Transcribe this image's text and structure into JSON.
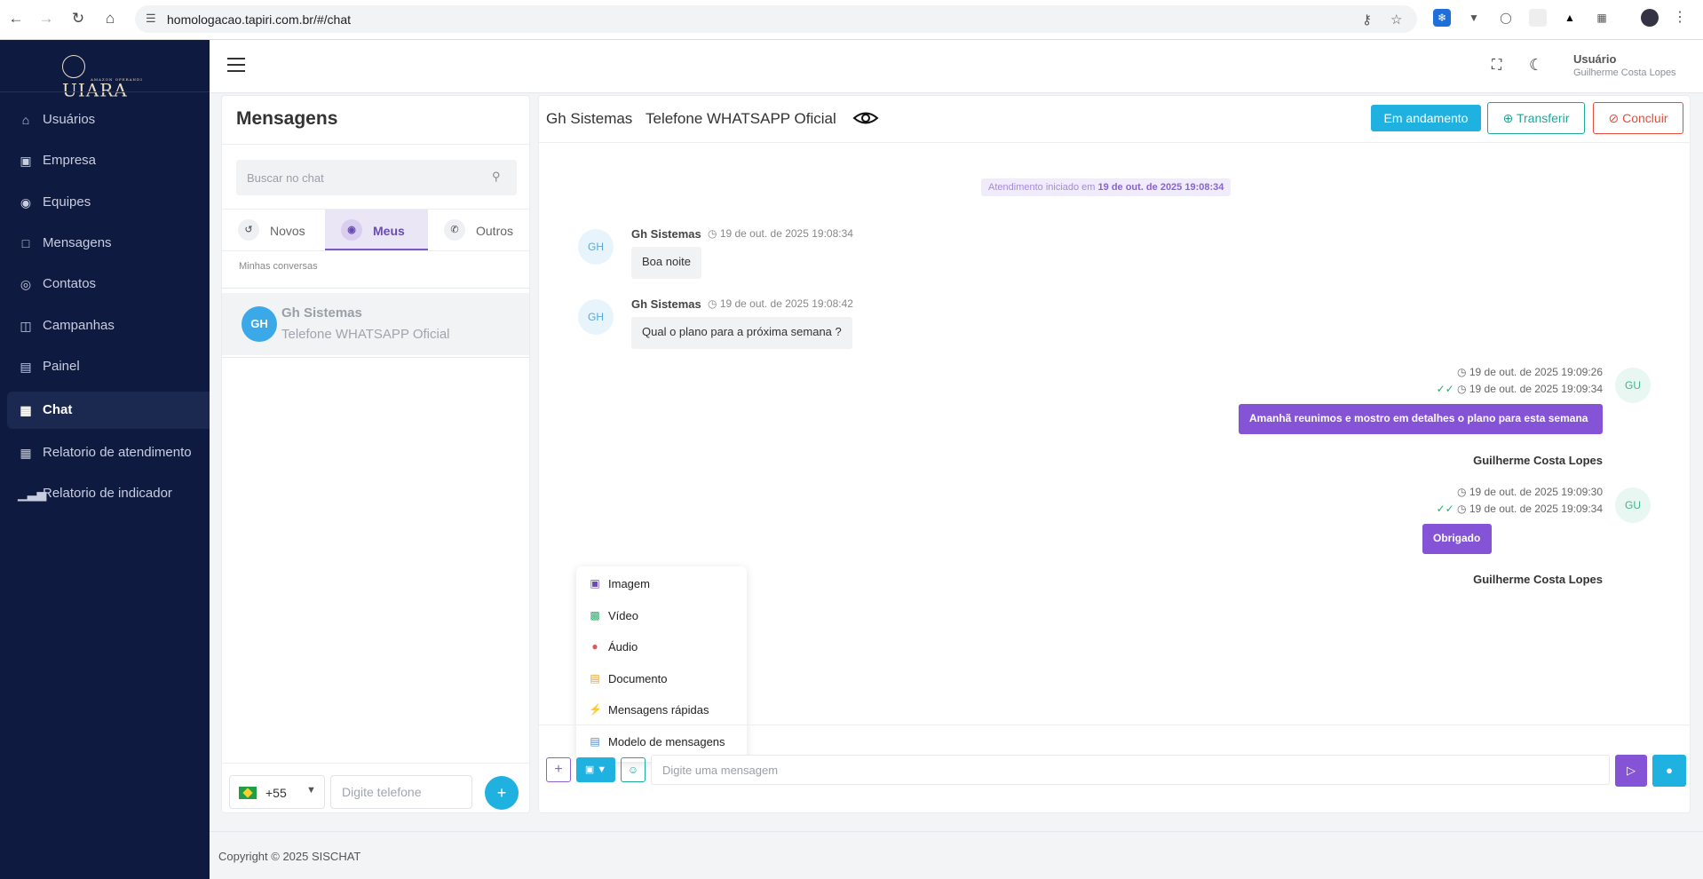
{
  "browser": {
    "url": "homologacao.tapiri.com.br/#/chat"
  },
  "sidebar": {
    "logo_text": "UIARA",
    "logo_sub": "AMAZON OPERANDI",
    "items": [
      {
        "label": "Usuários",
        "icon": "home-icon"
      },
      {
        "label": "Empresa",
        "icon": "archive-icon"
      },
      {
        "label": "Equipes",
        "icon": "fingerprint-icon"
      },
      {
        "label": "Mensagens",
        "icon": "file-icon"
      },
      {
        "label": "Contatos",
        "icon": "medal-icon"
      },
      {
        "label": "Campanhas",
        "icon": "gift-icon"
      },
      {
        "label": "Painel",
        "icon": "document-icon"
      },
      {
        "label": "Chat",
        "icon": "grid-icon"
      },
      {
        "label": "Relatorio de atendimento",
        "icon": "table-icon"
      },
      {
        "label": "Relatorio de indicador",
        "icon": "bar-chart-icon"
      }
    ]
  },
  "header": {
    "user_role": "Usuário",
    "user_name": "Guilherme Costa Lopes"
  },
  "messages_panel": {
    "title": "Mensagens",
    "search_placeholder": "Buscar no chat",
    "tabs": [
      {
        "label": "Novos"
      },
      {
        "label": "Meus"
      },
      {
        "label": "Outros"
      }
    ],
    "section_label": "Minhas conversas",
    "conversations": [
      {
        "initials": "GH",
        "name": "Gh Sistemas",
        "channel": "Telefone WHATSAPP Oficial"
      }
    ],
    "country_code": "+55",
    "phone_placeholder": "Digite telefone"
  },
  "chat": {
    "contact": "Gh Sistemas",
    "channel": "Telefone WHATSAPP Oficial",
    "status_button": "Em andamento",
    "transfer_button": "Transferir",
    "close_button": "Concluir",
    "started_prefix": "Atendimento iniciado em",
    "started_at": "19 de out. de 2025 19:08:34",
    "incoming": [
      {
        "initials": "GH",
        "name": "Gh Sistemas",
        "time": "19 de out. de 2025 19:08:34",
        "text": "Boa noite"
      },
      {
        "initials": "GH",
        "name": "Gh Sistemas",
        "time": "19 de out. de 2025 19:08:42",
        "text": "Qual o plano para a próxima semana ?"
      }
    ],
    "outgoing": [
      {
        "initials": "GU",
        "sent": "19 de out. de 2025 19:09:26",
        "read": "19 de out. de 2025 19:09:34",
        "text": "Amanhã reunimos e mostro em detalhes o plano para esta semana",
        "author": "Guilherme Costa Lopes"
      },
      {
        "initials": "GU",
        "sent": "19 de out. de 2025 19:09:30",
        "read": "19 de out. de 2025 19:09:34",
        "text": "Obrigado",
        "author": "Guilherme Costa Lopes"
      }
    ],
    "attach_menu": [
      {
        "label": "Imagem",
        "icon": "image-icon",
        "color": "#6a4bb3"
      },
      {
        "label": "Vídeo",
        "icon": "video-icon",
        "color": "#2eaa6a"
      },
      {
        "label": "Áudio",
        "icon": "microphone-icon",
        "color": "#e05555"
      },
      {
        "label": "Documento",
        "icon": "document-icon",
        "color": "#e0a030"
      },
      {
        "label": "Mensagens rápidas",
        "icon": "lightning-icon",
        "color": "#e0a030"
      },
      {
        "label": "Modelo de mensagens",
        "icon": "chat-template-icon",
        "color": "#4a8ad8"
      }
    ],
    "compose_placeholder": "Digite uma mensagem"
  },
  "footer": {
    "text": "Copyright © 2025 SISCHAT"
  },
  "colors": {
    "sidebar_bg": "#0e1a3f",
    "accent_purple": "#8553d6",
    "accent_blue": "#1fb1e0",
    "accent_teal": "#1aa99a",
    "danger": "#e74c3c"
  }
}
